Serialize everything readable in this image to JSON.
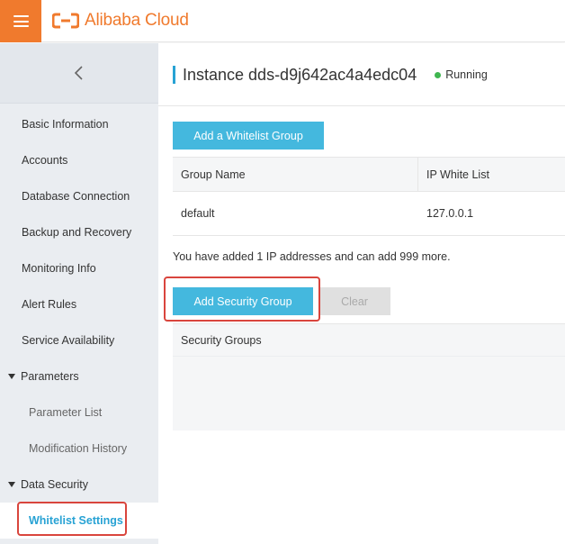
{
  "header": {
    "menu_icon": "hamburger-icon",
    "brand": "Alibaba Cloud",
    "brand_color": "#f07a2d"
  },
  "sidebar": {
    "back_icon": "chevron-left-icon",
    "items": [
      {
        "label": "Basic Information"
      },
      {
        "label": "Accounts"
      },
      {
        "label": "Database Connection"
      },
      {
        "label": "Backup and Recovery"
      },
      {
        "label": "Monitoring Info"
      },
      {
        "label": "Alert Rules"
      },
      {
        "label": "Service Availability"
      },
      {
        "label": "Parameters",
        "expanded": true
      },
      {
        "label": "Parameter List"
      },
      {
        "label": "Modification History"
      },
      {
        "label": "Data Security",
        "expanded": true
      },
      {
        "label": "Whitelist Settings",
        "active": true
      }
    ]
  },
  "main": {
    "title": "Instance dds-d9j642ac4a4edc04",
    "status": "Running",
    "status_color": "#3fb650",
    "add_whitelist_label": "Add a Whitelist Group",
    "whitelist_table": {
      "columns": [
        "Group Name",
        "IP White List"
      ],
      "rows": [
        [
          "default",
          "127.0.0.1"
        ]
      ]
    },
    "ip_info": "You have added 1 IP addresses and can add 999 more.",
    "add_security_group_label": "Add Security Group",
    "clear_label": "Clear",
    "security_groups_header": "Security Groups",
    "accent_color": "#44b8de",
    "highlight_color": "#d9453d"
  }
}
